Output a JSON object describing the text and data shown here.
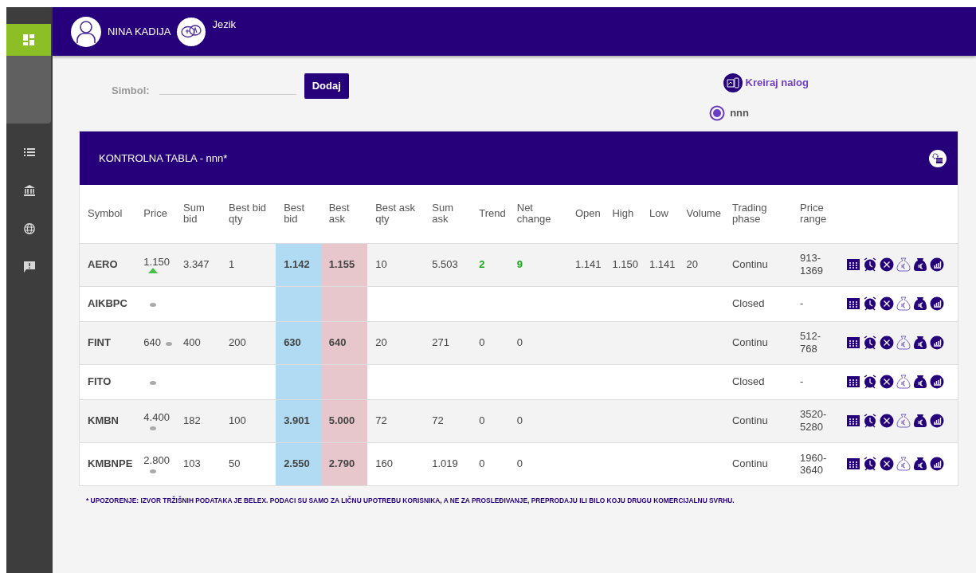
{
  "sidebar": {
    "items": [
      {
        "kind": "dashboard",
        "selected": true
      },
      {
        "kind": "list",
        "selected": false
      },
      {
        "kind": "bank",
        "selected": false
      },
      {
        "kind": "globe",
        "selected": false
      },
      {
        "kind": "feedback",
        "selected": false
      }
    ]
  },
  "header": {
    "user_name": "NINA KADIJA",
    "language": "Jezik"
  },
  "toolbar": {
    "symbol_label": "Simbol:",
    "add_button": "Dodaj",
    "create_order": "Kreiraj nalog",
    "radios": [
      {
        "label": "nnn",
        "selected": true
      }
    ]
  },
  "panel": {
    "title": "KONTROLNA TABLA - nnn*"
  },
  "table": {
    "columns": [
      "Symbol",
      "Price",
      "Sum bid",
      "Best bid qty",
      "Best bid",
      "Best ask",
      "Best ask qty",
      "Sum ask",
      "Trend",
      "Net change",
      "Open",
      "High",
      "Low",
      "Volume",
      "Trading phase",
      "Price range"
    ],
    "rows": [
      {
        "symbol": "AERO",
        "price": "1.150",
        "price_up": true,
        "sum_bid": "3.347",
        "best_bid_qty": "1",
        "best_bid": "1.142",
        "best_ask": "1.155",
        "best_ask_qty": "10",
        "sum_ask": "5.503",
        "trend": "2",
        "net_change": "9",
        "open": "1.141",
        "high": "1.150",
        "low": "1.141",
        "volume": "20",
        "trading_phase": "Continu",
        "price_range": "913-1369"
      },
      {
        "symbol": "AIKBPC",
        "price": "",
        "price_up": false,
        "sum_bid": "",
        "best_bid_qty": "",
        "best_bid": "",
        "best_ask": "",
        "best_ask_qty": "",
        "sum_ask": "",
        "trend": "",
        "net_change": "",
        "open": "",
        "high": "",
        "low": "",
        "volume": "",
        "trading_phase": "Closed",
        "price_range": "-"
      },
      {
        "symbol": "FINT",
        "price": "640",
        "price_up": false,
        "sum_bid": "400",
        "best_bid_qty": "200",
        "best_bid": "630",
        "best_ask": "640",
        "best_ask_qty": "20",
        "sum_ask": "271",
        "trend": "0",
        "net_change": "0",
        "open": "",
        "high": "",
        "low": "",
        "volume": "",
        "trading_phase": "Continu",
        "price_range": "512-768"
      },
      {
        "symbol": "FITO",
        "price": "",
        "price_up": false,
        "sum_bid": "",
        "best_bid_qty": "",
        "best_bid": "",
        "best_ask": "",
        "best_ask_qty": "",
        "sum_ask": "",
        "trend": "",
        "net_change": "",
        "open": "",
        "high": "",
        "low": "",
        "volume": "",
        "trading_phase": "Closed",
        "price_range": "-"
      },
      {
        "symbol": "KMBN",
        "price": "4.400",
        "price_up": false,
        "sum_bid": "182",
        "best_bid_qty": "100",
        "best_bid": "3.901",
        "best_ask": "5.000",
        "best_ask_qty": "72",
        "sum_ask": "72",
        "trend": "0",
        "net_change": "0",
        "open": "",
        "high": "",
        "low": "",
        "volume": "",
        "trading_phase": "Continu",
        "price_range": "3520-5280"
      },
      {
        "symbol": "KMBNPE",
        "price": "2.800",
        "price_up": false,
        "sum_bid": "103",
        "best_bid_qty": "50",
        "best_bid": "2.550",
        "best_ask": "2.790",
        "best_ask_qty": "160",
        "sum_ask": "1.019",
        "trend": "0",
        "net_change": "0",
        "open": "",
        "high": "",
        "low": "",
        "volume": "",
        "trading_phase": "Continu",
        "price_range": "1960-3640"
      }
    ]
  },
  "disclaimer": "* UPOZORENJE: IZVOR TRŽIŠNIH PODATAKA JE BELEX. PODACI SU SAMO ZA LIČNU UPOTREBU KORISNIKA, A NE ZA PROSLEĐIVANJE, PREPRODAJU ILI BILO KOJU DRUGU KOMERCIJALNU SVRHU."
}
